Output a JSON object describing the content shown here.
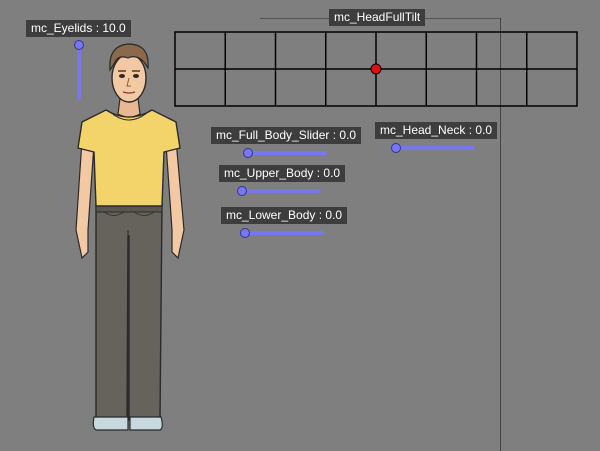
{
  "controls": {
    "eyelids": {
      "name": "mc_Eyelids",
      "value": "10.0",
      "fraction": 1.0
    },
    "head_full_tilt": {
      "name": "mc_HeadFullTilt",
      "columns": 8,
      "rows": 2,
      "point": [
        0.5,
        0.5
      ]
    },
    "full_body_slider": {
      "name": "mc_Full_Body_Slider",
      "value": "0.0",
      "fraction": 0.0
    },
    "head_neck": {
      "name": "mc_Head_Neck",
      "value": "0.0",
      "fraction": 0.0
    },
    "upper_body": {
      "name": "mc_Upper_Body",
      "value": "0.0",
      "fraction": 0.0
    },
    "lower_body": {
      "name": "mc_Lower_Body",
      "value": "0.0",
      "fraction": 0.0
    }
  },
  "colors": {
    "background": "#7f7f7f",
    "label_bg": "#3d3d3d",
    "slider": "#7777ee",
    "grid_point": "#e01010",
    "shirt": "#f2d46a",
    "pants": "#66625c",
    "skin": "#f3c9a4",
    "hair": "#8a6a4a"
  }
}
